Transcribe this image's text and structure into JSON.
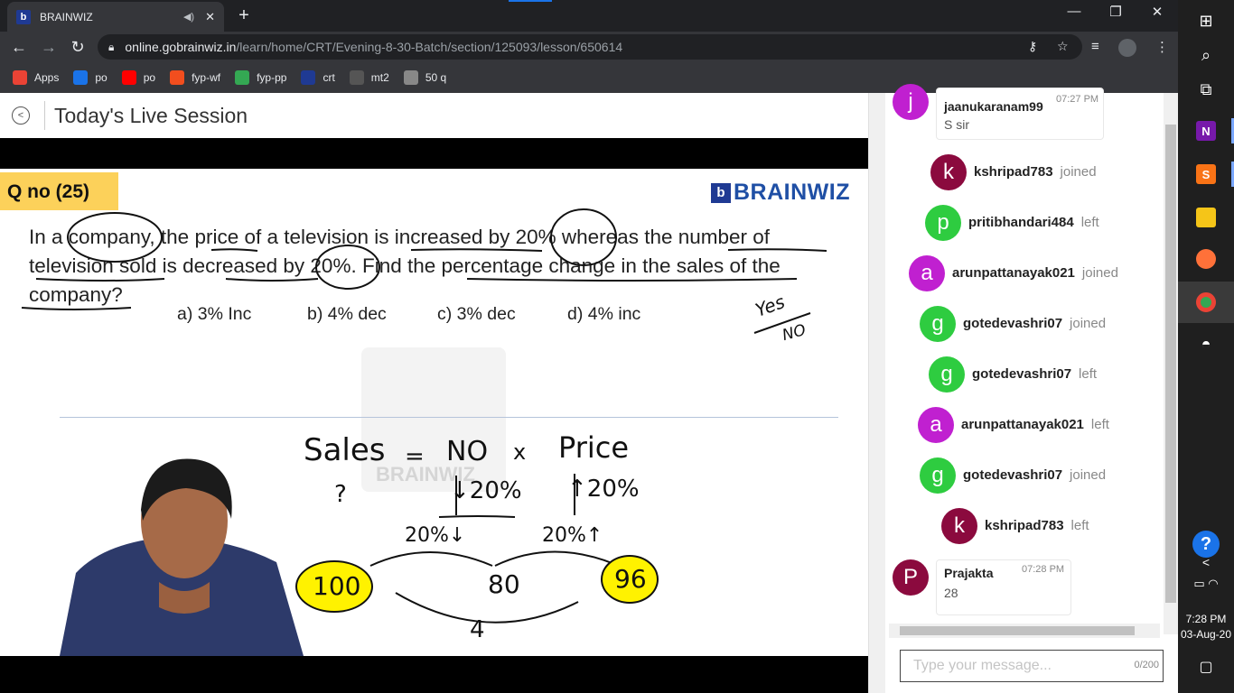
{
  "browser": {
    "tab_title": "BRAINWIZ",
    "tab_favicon": "b",
    "url_host": "online.gobrainwiz.in",
    "url_path": "/learn/home/CRT/Evening-8-30-Batch/section/125093/lesson/650614",
    "bookmarks": [
      {
        "label": "Apps",
        "icon": "apps-grid-icon",
        "color": "#ea4335"
      },
      {
        "label": "po",
        "icon": "e-icon",
        "color": "#1a73e8"
      },
      {
        "label": "po",
        "icon": "youtube-icon",
        "color": "#ff0000"
      },
      {
        "label": "fyp-wf",
        "icon": "figma-icon",
        "color": "#f24e1e"
      },
      {
        "label": "fyp-pp",
        "icon": "pd-icon",
        "color": "#34a853"
      },
      {
        "label": "crt",
        "icon": "brainwiz-icon",
        "color": "#1f3a93"
      },
      {
        "label": "mt2",
        "icon": "cc-icon",
        "color": "#555555"
      },
      {
        "label": "50 q",
        "icon": "globe-icon",
        "color": "#888888"
      }
    ]
  },
  "page": {
    "title": "Today's Live Session"
  },
  "slide": {
    "qno": "Q no (25)",
    "brand": "BRAINWIZ",
    "question_line1": "In a company, the price of a television is increased by 20% whereas the number of",
    "question_line2": "television sold is decreased by 20%. Find the percentage change in the sales of the",
    "question_line3": "company?",
    "options": [
      "a) 3% Inc",
      "b) 4% dec",
      "c) 3% dec",
      "d) 4% inc"
    ],
    "watermark": "BRAINWIZ",
    "handwriting": {
      "yes": "Yes",
      "no": "NO",
      "equation_left": "Sales",
      "equation_eq": "=",
      "equation_no": "NO",
      "equation_x": "x",
      "equation_price": "Price",
      "q_mark": "?",
      "down20": "↓20%",
      "up20": "↑20%",
      "step1": "20%↓",
      "step2": "20%↑",
      "v100": "100",
      "v80": "80",
      "v96": "96",
      "diff": "4"
    }
  },
  "chat": {
    "messages_top": {
      "user": "jaanukaranam99",
      "time": "07:27 PM",
      "text": "S sir",
      "avatar": "j",
      "color": "#c020d0"
    },
    "events": [
      {
        "user": "kshripad783",
        "action": "joined",
        "avatar": "k",
        "color": "#8b0a3e"
      },
      {
        "user": "pritibhandari484",
        "action": "left",
        "avatar": "p",
        "color": "#2ecc40"
      },
      {
        "user": "arunpattanayak021",
        "action": "joined",
        "avatar": "a",
        "color": "#c020d0"
      },
      {
        "user": "gotedevashri07",
        "action": "joined",
        "avatar": "g",
        "color": "#2ecc40"
      },
      {
        "user": "gotedevashri07",
        "action": "left",
        "avatar": "g",
        "color": "#2ecc40"
      },
      {
        "user": "arunpattanayak021",
        "action": "left",
        "avatar": "a",
        "color": "#c020d0"
      },
      {
        "user": "gotedevashri07",
        "action": "joined",
        "avatar": "g",
        "color": "#2ecc40"
      },
      {
        "user": "kshripad783",
        "action": "left",
        "avatar": "k",
        "color": "#8b0a3e"
      }
    ],
    "message_bottom": {
      "user": "Prajakta",
      "time": "07:28 PM",
      "text": "28",
      "avatar": "P",
      "color": "#8b0a3e"
    },
    "input_placeholder": "Type your message...",
    "char_count": "0/200"
  },
  "taskbar": {
    "time": "7:28 PM",
    "date": "03-Aug-20"
  }
}
